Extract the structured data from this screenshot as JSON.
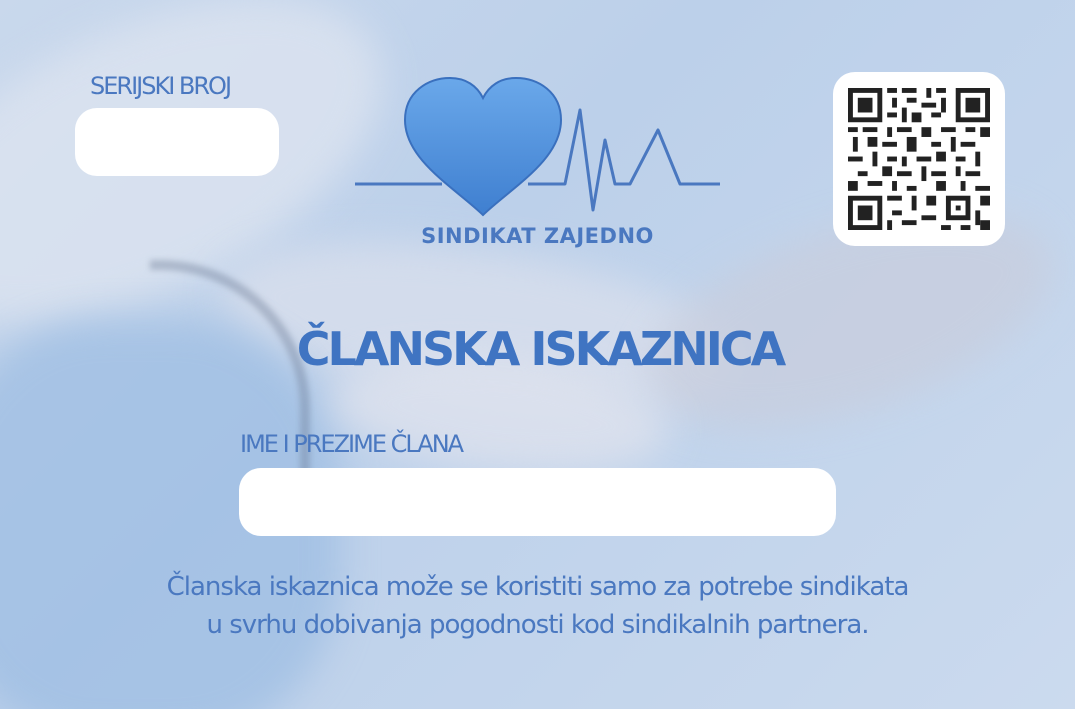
{
  "card": {
    "serial_label": "SERIJSKI BROJ",
    "serial_value": "",
    "brand_name": "SINDIKAT ZAJEDNO",
    "title": "ČLANSKA ISKAZNICA",
    "name_label": "IME I PREZIME ČLANA",
    "name_value": "",
    "note_line1": "Članska iskaznica može se koristiti samo za potrebe sindikata",
    "note_line2": "u svrhu dobivanja pogodnosti kod sindikalnih partnera."
  },
  "colors": {
    "accent": "#4a78c0",
    "heart": "#5a9ae0",
    "background": "#c3d5ec",
    "field": "#ffffff"
  },
  "icons": {
    "logo": "heart-pulse-icon",
    "qr": "qr-code-icon"
  }
}
